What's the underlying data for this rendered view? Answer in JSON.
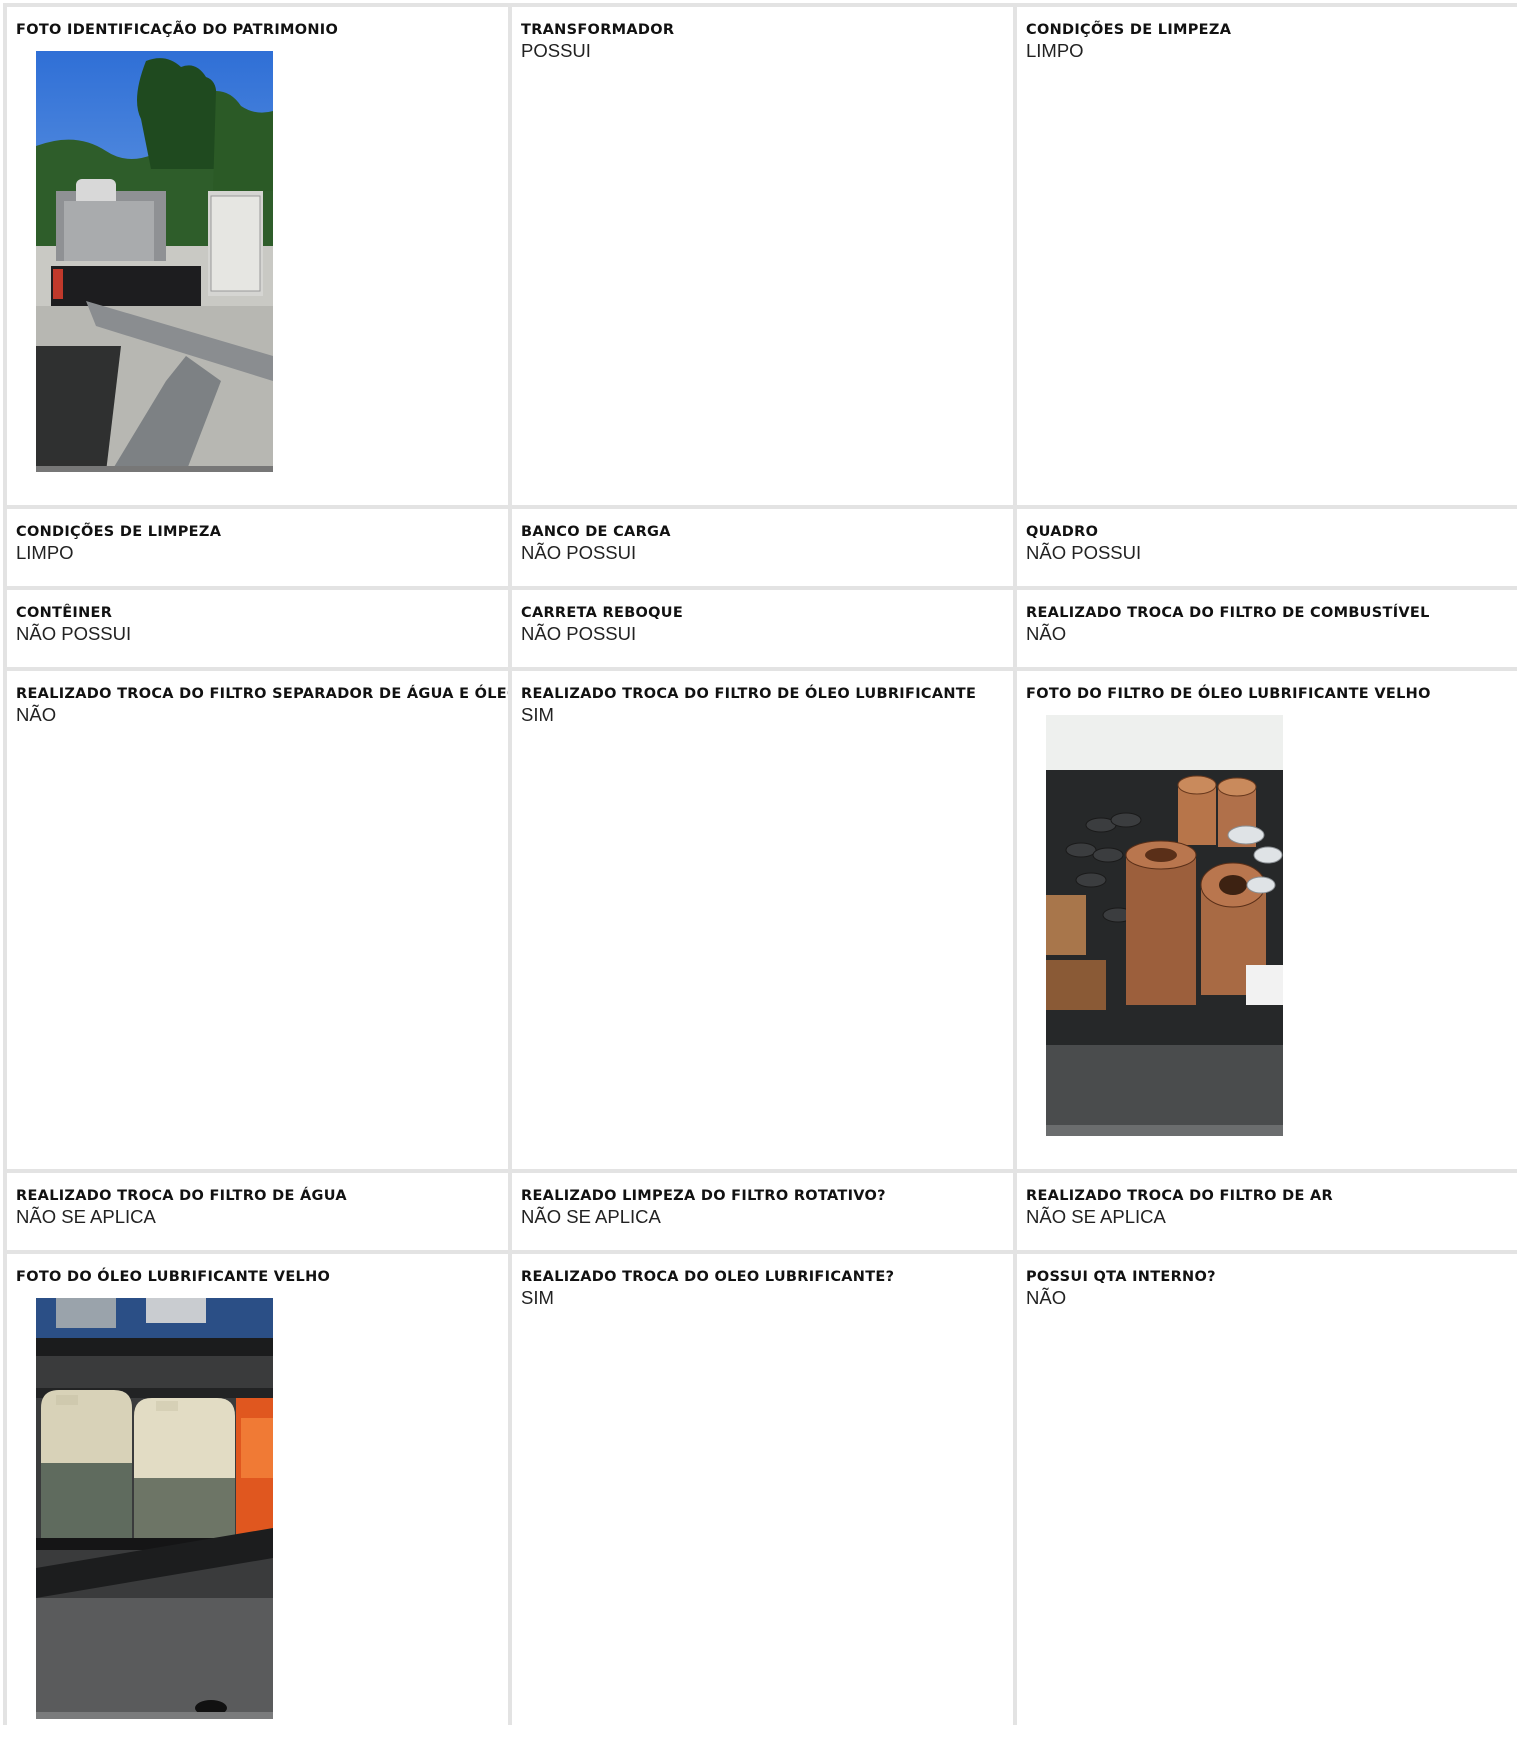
{
  "fields": [
    {
      "label": "FOTO IDENTIFICAÇÃO DO PATRIMONIO",
      "value": ""
    },
    {
      "label": "TRANSFORMADOR",
      "value": "POSSUI"
    },
    {
      "label": "CONDIÇÕES DE LIMPEZA",
      "value": "LIMPO"
    },
    {
      "label": "CONDIÇÕES DE LIMPEZA",
      "value": "LIMPO"
    },
    {
      "label": "BANCO DE CARGA",
      "value": "NÃO POSSUI"
    },
    {
      "label": "QUADRO",
      "value": "NÃO POSSUI"
    },
    {
      "label": "CONTÊINER",
      "value": "NÃO POSSUI"
    },
    {
      "label": "CARRETA REBOQUE",
      "value": "NÃO POSSUI"
    },
    {
      "label": "REALIZADO TROCA DO FILTRO DE COMBUSTÍVEL",
      "value": "NÃO"
    },
    {
      "label": "REALIZADO TROCA DO FILTRO SEPARADOR DE ÁGUA E ÓLEO",
      "value": "NÃO"
    },
    {
      "label": "REALIZADO TROCA DO FILTRO DE ÓLEO LUBRIFICANTE",
      "value": "SIM"
    },
    {
      "label": "FOTO DO FILTRO DE ÓLEO LUBRIFICANTE VELHO",
      "value": ""
    },
    {
      "label": "REALIZADO TROCA DO FILTRO DE ÁGUA",
      "value": "NÃO SE APLICA"
    },
    {
      "label": "REALIZADO LIMPEZA DO FILTRO ROTATIVO?",
      "value": "NÃO SE APLICA"
    },
    {
      "label": "REALIZADO TROCA DO FILTRO DE AR",
      "value": "NÃO SE APLICA"
    },
    {
      "label": "FOTO DO ÓLEO LUBRIFICANTE VELHO",
      "value": ""
    },
    {
      "label": "REALIZADO TROCA DO OLEO LUBRIFICANTE?",
      "value": "SIM"
    },
    {
      "label": "POSSUI QTA INTERNO?",
      "value": "NÃO"
    }
  ]
}
